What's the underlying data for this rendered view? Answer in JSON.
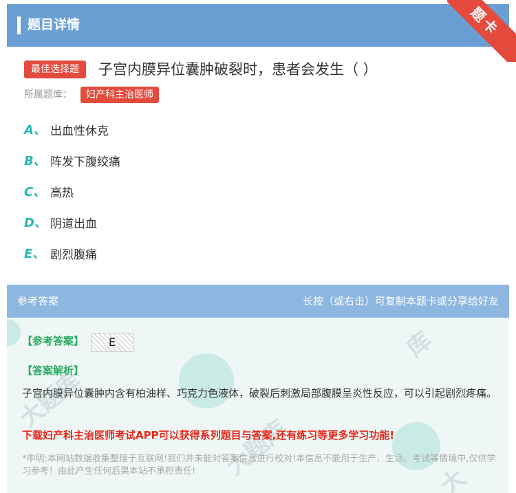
{
  "header": {
    "title": "题目详情",
    "corner_badge": "题卡"
  },
  "question": {
    "type_tag": "最佳选择题",
    "text": "子宫内膜异位囊肿破裂时，患者会发生（ ）",
    "bank_label": "所属题库：",
    "bank_name": "妇产科主治医师",
    "options": [
      {
        "letter": "A、",
        "text": "出血性休克"
      },
      {
        "letter": "B、",
        "text": "阵发下腹绞痛"
      },
      {
        "letter": "C、",
        "text": "高热"
      },
      {
        "letter": "D、",
        "text": "阴道出血"
      },
      {
        "letter": "E、",
        "text": "剧烈腹痛"
      }
    ]
  },
  "answer": {
    "header_left": "参考答案",
    "header_right": "长按（或右击）可复制本题卡或分享给好友",
    "key_label": "【参考答案】",
    "key_value": "E",
    "analysis_label": "【答案解析】",
    "analysis_text": "子宫内膜异位囊肿内含有柏油样、巧克力色液体，破裂后刺激局部腹膜呈炎性反应，可以引起剧烈疼痛。",
    "promo": "下载妇产科主治医师考试APP可以获得系列题目与答案,还有练习等更多学习功能!",
    "disclaimer": "*申明:本网站数据收集整理于互联网!我们并未能对答案信息进行校对!本信息不能用于生产、生活、考试等情境中,仅供学习参考！由此产生任何后果本站不承担责任!"
  },
  "colors": {
    "header_blue": "#6a9fd4",
    "answer_header_blue": "#8db6e0",
    "tag_red": "#e44b3c",
    "option_teal": "#28b8b0",
    "label_green": "#2daa63",
    "promo_red": "#e8261a"
  }
}
